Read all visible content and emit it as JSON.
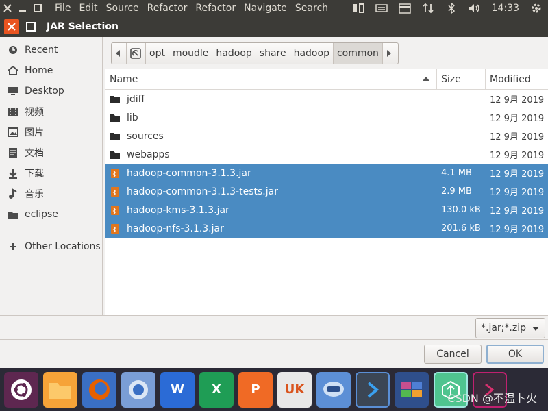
{
  "menubar": {
    "items": [
      "File",
      "Edit",
      "Source",
      "Refactor",
      "Refactor",
      "Navigate",
      "Search"
    ],
    "clock": "14:33"
  },
  "dialog": {
    "title": "JAR Selection"
  },
  "sidebar": {
    "places": [
      {
        "label": "Recent",
        "icon": "clock-icon"
      },
      {
        "label": "Home",
        "icon": "home-icon"
      },
      {
        "label": "Desktop",
        "icon": "desktop-icon"
      },
      {
        "label": "视频",
        "icon": "video-icon"
      },
      {
        "label": "图片",
        "icon": "image-icon"
      },
      {
        "label": "文档",
        "icon": "document-icon"
      },
      {
        "label": "下载",
        "icon": "download-icon"
      },
      {
        "label": "音乐",
        "icon": "music-icon"
      },
      {
        "label": "eclipse",
        "icon": "folder-icon"
      }
    ],
    "other": "Other Locations"
  },
  "pathbar": [
    "opt",
    "moudle",
    "hadoop",
    "share",
    "hadoop",
    "common"
  ],
  "columns": {
    "name": "Name",
    "size": "Size",
    "modified": "Modified"
  },
  "files": [
    {
      "name": "jdiff",
      "size": "",
      "modified": "12 9月 2019",
      "type": "folder",
      "selected": false
    },
    {
      "name": "lib",
      "size": "",
      "modified": "12 9月 2019",
      "type": "folder",
      "selected": false
    },
    {
      "name": "sources",
      "size": "",
      "modified": "12 9月 2019",
      "type": "folder",
      "selected": false
    },
    {
      "name": "webapps",
      "size": "",
      "modified": "12 9月 2019",
      "type": "folder",
      "selected": false
    },
    {
      "name": "hadoop-common-3.1.3.jar",
      "size": "4.1 MB",
      "modified": "12 9月 2019",
      "type": "jar",
      "selected": true
    },
    {
      "name": "hadoop-common-3.1.3-tests.jar",
      "size": "2.9 MB",
      "modified": "12 9月 2019",
      "type": "jar",
      "selected": true
    },
    {
      "name": "hadoop-kms-3.1.3.jar",
      "size": "130.0 kB",
      "modified": "12 9月 2019",
      "type": "jar",
      "selected": true
    },
    {
      "name": "hadoop-nfs-3.1.3.jar",
      "size": "201.6 kB",
      "modified": "12 9月 2019",
      "type": "jar",
      "selected": true
    }
  ],
  "filter": {
    "value": "*.jar;*.zip"
  },
  "buttons": {
    "cancel": "Cancel",
    "ok": "OK"
  },
  "dock": {
    "watermark": "CSDN @不温卜火"
  },
  "colors": {
    "selection": "#4a8bc2",
    "close_button": "#e95420",
    "panel": "#3c3b37"
  }
}
